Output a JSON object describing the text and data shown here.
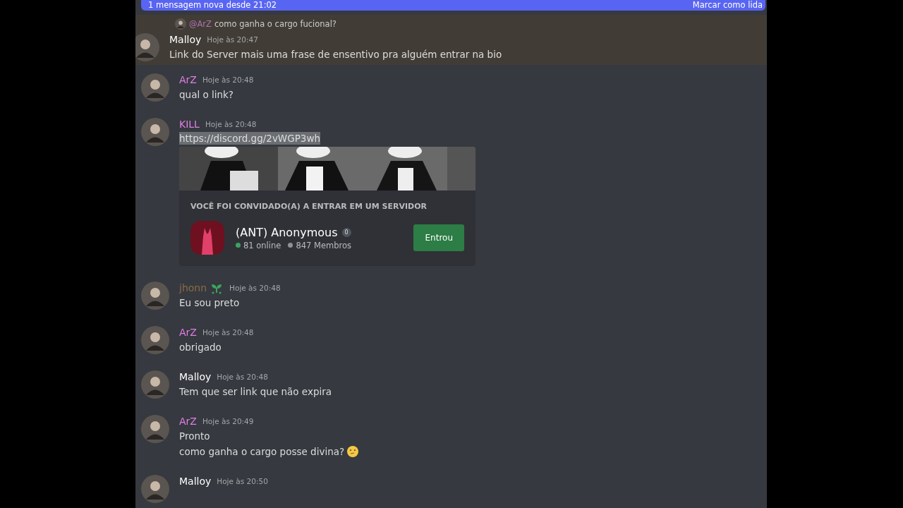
{
  "banner": {
    "text": "1 mensagem nova desde 21:02",
    "action": "Marcar como lida"
  },
  "messages": [
    {
      "author": "Malloy",
      "color": "#ffffff",
      "time": "Hoje às 20:47",
      "highlighted": true,
      "reply": {
        "author": "@ArZ",
        "text": "como ganha o cargo fucional?"
      },
      "lines": [
        {
          "text": "Link do Server mais uma frase de ensentivo pra alguém entrar na bio",
          "emoji": false
        }
      ]
    },
    {
      "author": "ArZ",
      "color": "#e27ee6",
      "time": "Hoje às 20:48",
      "highlighted": false,
      "lines": [
        {
          "text": "qual o link?",
          "emoji": false
        }
      ]
    },
    {
      "author": "KILL",
      "color": "#e27ee6",
      "time": "Hoje às 20:48",
      "highlighted": false,
      "link": "https://discord.gg/2vWGP3wh",
      "invite": {
        "heading": "VOCÊ FOI CONVIDADO(A) A ENTRAR EM UM SERVIDOR",
        "server": "(ANT) Anonymous",
        "badge": "0",
        "online": "81 online",
        "members": "847 Membros",
        "button": "Entrou",
        "joined": true
      }
    },
    {
      "author": "jhonn",
      "color": "#8a6a48",
      "time": "Hoje às 20:48",
      "highlighted": false,
      "leaf_badge": true,
      "lines": [
        {
          "text": "Eu sou preto",
          "emoji": false
        }
      ]
    },
    {
      "author": "ArZ",
      "color": "#e27ee6",
      "time": "Hoje às 20:48",
      "highlighted": false,
      "lines": [
        {
          "text": "obrigado",
          "emoji": false
        }
      ]
    },
    {
      "author": "Malloy",
      "color": "#ffffff",
      "time": "Hoje às 20:48",
      "highlighted": false,
      "lines": [
        {
          "text": "Tem que ser link que não expira",
          "emoji": false
        }
      ]
    },
    {
      "author": "ArZ",
      "color": "#e27ee6",
      "time": "Hoje às 20:49",
      "highlighted": false,
      "lines": [
        {
          "text": "Pronto",
          "emoji": false
        },
        {
          "text": "como ganha o cargo posse divina?",
          "emoji": true
        }
      ]
    },
    {
      "author": "Malloy",
      "color": "#ffffff",
      "time": "Hoje às 20:50",
      "highlighted": false
    }
  ]
}
